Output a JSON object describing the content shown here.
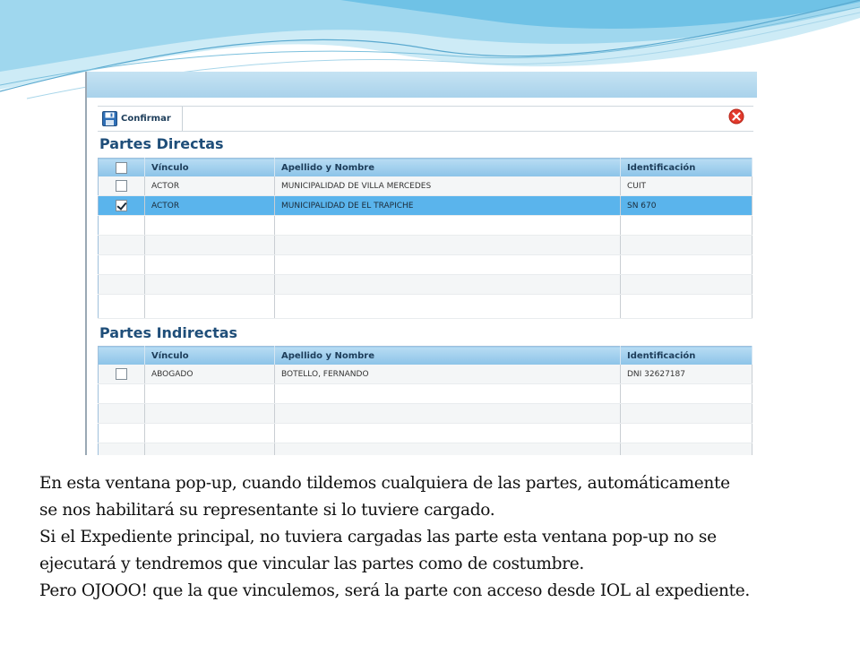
{
  "toolbar": {
    "confirm_label": "Confirmar"
  },
  "direct": {
    "title": "Partes Directas",
    "headers": [
      "Vínculo",
      "Apellido y Nombre",
      "Identificación"
    ],
    "rows": [
      {
        "vinculo": "ACTOR",
        "nombre": "MUNICIPALIDAD DE VILLA MERCEDES",
        "id": "CUIT",
        "checked": false
      },
      {
        "vinculo": "ACTOR",
        "nombre": "MUNICIPALIDAD DE EL TRAPICHE",
        "id": "SN 670",
        "checked": true
      }
    ]
  },
  "indirect": {
    "title": "Partes Indirectas",
    "headers": [
      "Vínculo",
      "Apellido y Nombre",
      "Identificación"
    ],
    "rows": [
      {
        "vinculo": "ABOGADO",
        "nombre": "BOTELLO, FERNANDO",
        "id": "DNI 32627187",
        "checked": false
      }
    ]
  },
  "description": {
    "lines": [
      "En esta ventana pop-up,  cuando tildemos cualquiera de las partes, automáticamente",
      "se nos habilitará su representante si lo tuviere cargado.",
      "Si el Expediente principal, no tuviera cargadas las parte esta ventana pop-up no se",
      "ejecutará y tendremos que vincular las partes como de costumbre.",
      "Pero OJOOO! que la que vinculemos, será la parte con acceso desde IOL al expediente."
    ]
  },
  "colors": {
    "accent": "#1f4e79",
    "selected_row": "#5ab4ec",
    "header": "#8cc3e8"
  }
}
